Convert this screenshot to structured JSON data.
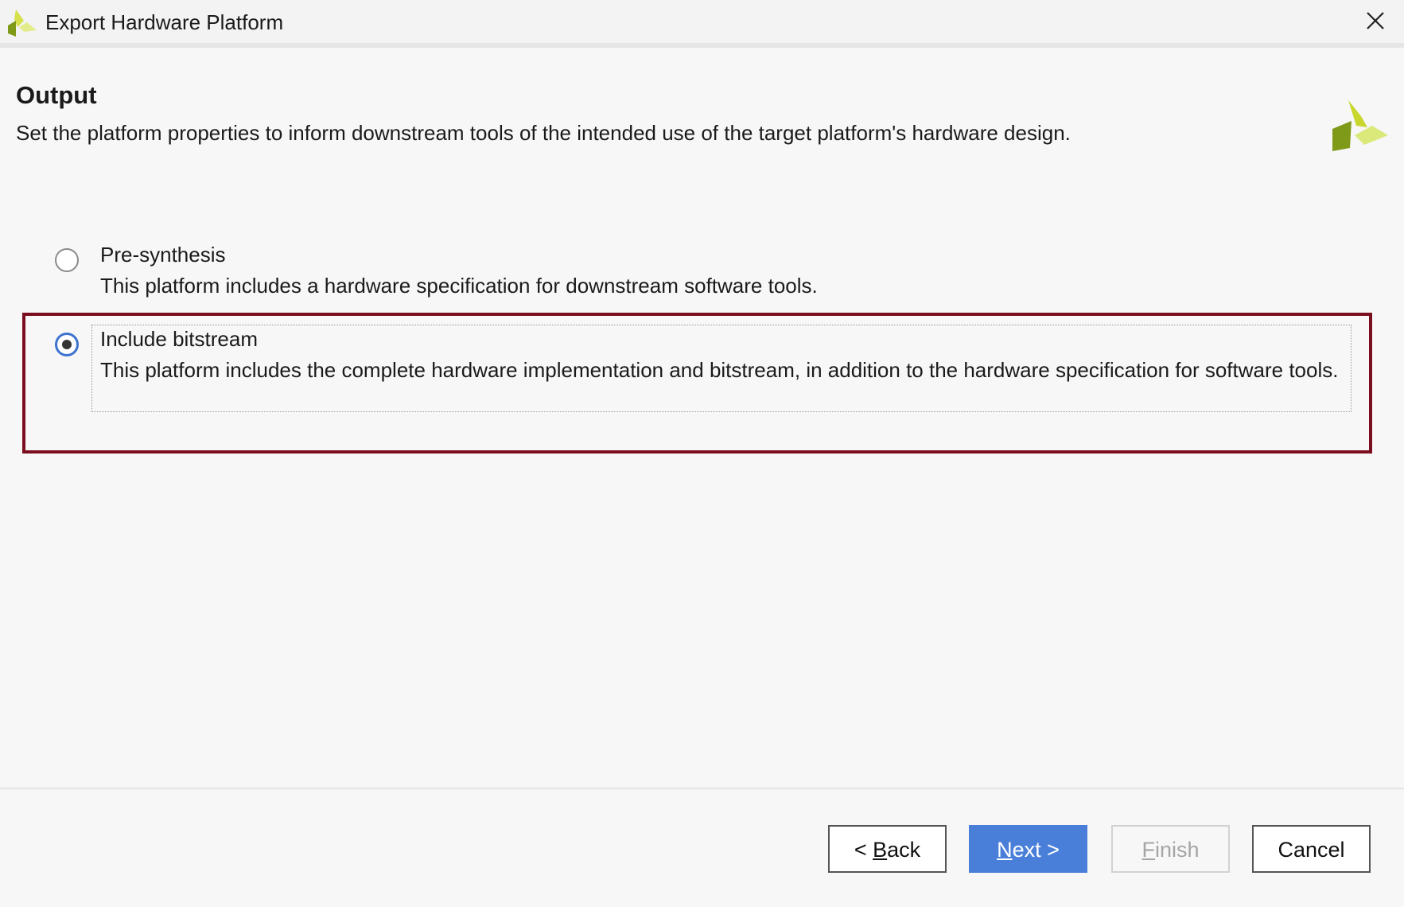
{
  "window": {
    "title": "Export Hardware Platform",
    "app_icon": "xilinx-logo-icon",
    "close_icon": "close-icon"
  },
  "header": {
    "title": "Output",
    "description": "Set the platform properties to inform downstream tools of the intended use of the target platform's hardware design.",
    "logo": "xilinx-logo-icon"
  },
  "options": [
    {
      "label": "Pre-synthesis",
      "description": "This platform includes a hardware specification for downstream software tools.",
      "selected": false
    },
    {
      "label": "Include bitstream",
      "description": "This platform includes the complete hardware implementation and bitstream, in addition to the hardware specification for software tools.",
      "selected": true
    }
  ],
  "buttons": {
    "back": {
      "prefix": "< ",
      "mnemonic": "B",
      "rest": "ack"
    },
    "next": {
      "mnemonic": "N",
      "rest": "ext >"
    },
    "finish": {
      "mnemonic": "F",
      "rest": "inish",
      "enabled": false
    },
    "cancel": {
      "label": "Cancel"
    }
  },
  "colors": {
    "accent": "#4a7fd9",
    "highlight_border": "#7a0d1e",
    "logo_light": "#d5e04a",
    "logo_dark": "#7f9a18"
  }
}
